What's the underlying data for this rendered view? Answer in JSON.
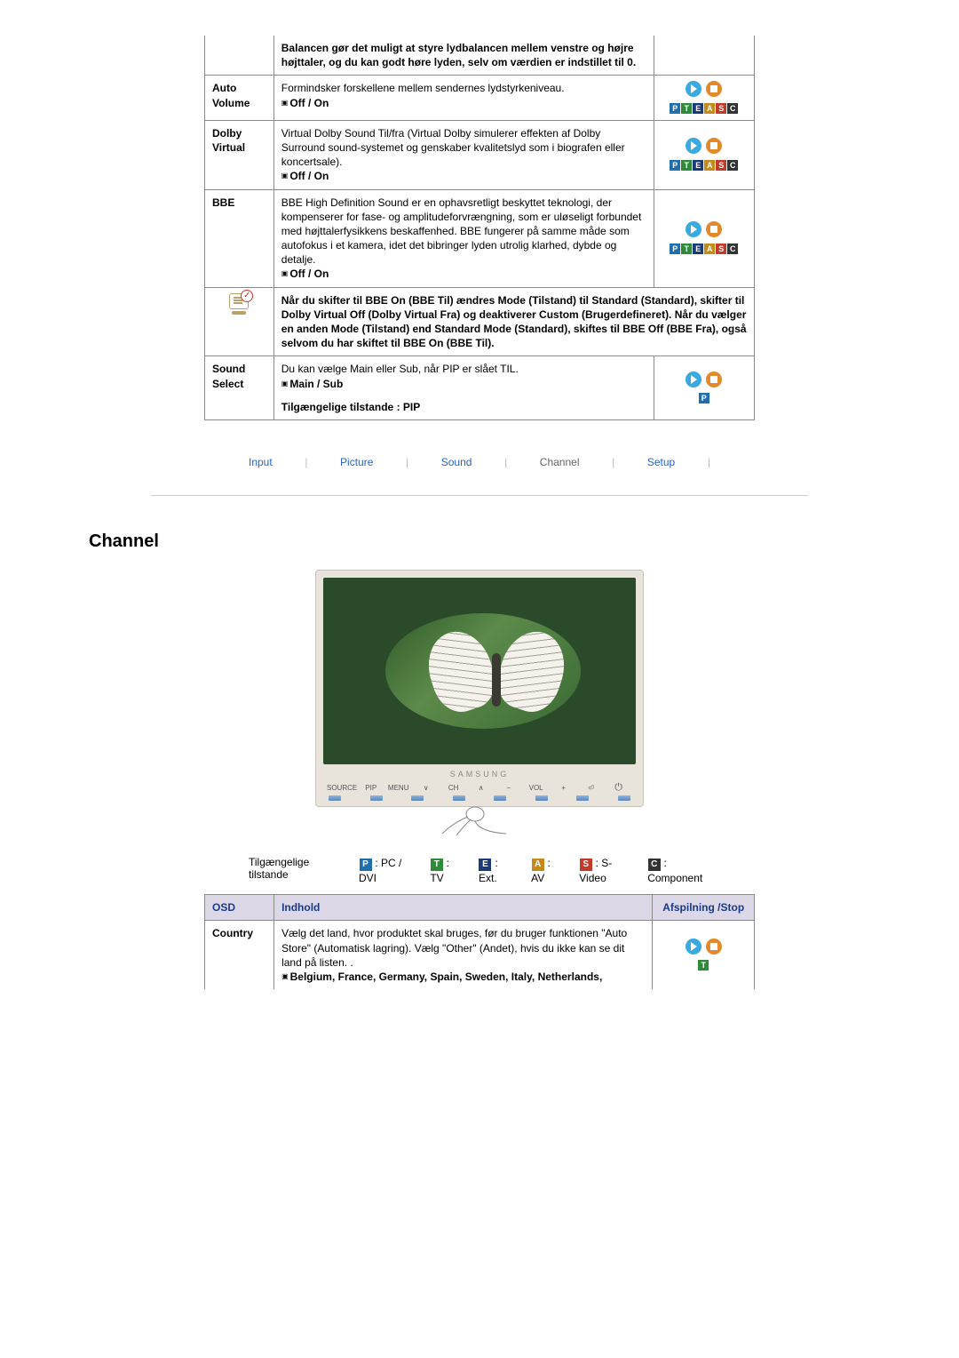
{
  "sound_table": {
    "balance_note": "Balancen gør det muligt at styre lydbalancen mellem venstre og højre højttaler, og du kan godt høre lyden, selv om værdien er indstillet til 0.",
    "auto_volume": {
      "label": "Auto Volume",
      "desc": "Formindsker forskellene mellem sendernes lydstyrkeniveau.",
      "opts": "Off / On"
    },
    "dolby": {
      "label": "Dolby Virtual",
      "desc": "Virtual Dolby Sound Til/fra (Virtual Dolby simulerer effekten af Dolby Surround sound-systemet og genskaber kvalitetslyd som i biografen eller koncertsale).",
      "opts": "Off / On"
    },
    "bbe": {
      "label": "BBE",
      "desc": "BBE High Definition Sound er en ophavsretligt beskyttet teknologi, der kompenserer for fase- og amplitudeforvrængning, som er uløseligt forbundet med højttalerfysikkens beskaffenhed. BBE fungerer på samme måde som autofokus i et kamera, idet det bibringer lyden utrolig klarhed, dybde og detalje.",
      "opts": "Off / On"
    },
    "bbe_note": "Når du skifter til BBE On (BBE Til) ændres Mode (Tilstand) til Standard (Standard), skifter til Dolby Virtual Off (Dolby Virtual Fra) og deaktiverer Custom (Brugerdefineret). Når du vælger en anden Mode (Tilstand) end Standard Mode (Standard), skiftes til BBE Off (BBE Fra), også selvom du har skiftet til BBE On (BBE Til).",
    "sound_select": {
      "label": "Sound Select",
      "desc": "Du kan vælge Main eller Sub, når PIP er slået TIL.",
      "opts": "Main / Sub",
      "modes_line": "Tilgængelige tilstande : PIP"
    }
  },
  "tabs": {
    "input": "Input",
    "picture": "Picture",
    "sound": "Sound",
    "channel": "Channel",
    "setup": "Setup"
  },
  "section_title": "Channel",
  "monitor": {
    "brand": "SAMSUNG",
    "buttons": {
      "source": "SOURCE",
      "pip": "PIP",
      "menu": "MENU",
      "ch_down": "∨",
      "ch": "CH",
      "ch_up": "∧",
      "vol_minus": "−",
      "vol": "VOL",
      "vol_plus": "+",
      "enter": "⏎",
      "power": "⏻"
    }
  },
  "legend": {
    "label1": "Tilgængelige",
    "label2": "tilstande",
    "p": ": PC / DVI",
    "t": ": TV",
    "e": ": Ext.",
    "a": ": AV",
    "s": ": S-Video",
    "c": ": Component"
  },
  "channel_table": {
    "hdr_osd": "OSD",
    "hdr_content": "Indhold",
    "hdr_play": "Afspilning /Stop",
    "country": {
      "label": "Country",
      "desc": "Vælg det land, hvor produktet skal bruges, før du bruger funktionen \"Auto Store\" (Automatisk lagring). Vælg \"Other\" (Andet), hvis du ikke kan se dit land på listen. .",
      "opts": "Belgium, France, Germany, Spain, Sweden, Italy, Netherlands,"
    }
  }
}
